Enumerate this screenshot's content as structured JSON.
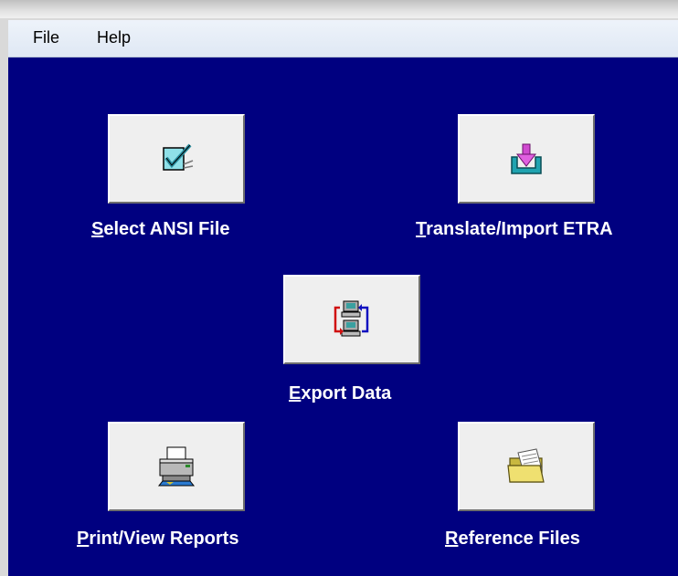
{
  "menu": {
    "file": "File",
    "help": "Help"
  },
  "buttons": {
    "select_ansi": {
      "accel": "S",
      "rest": "elect ANSI File",
      "icon": "checkmark-icon"
    },
    "translate_import": {
      "accel": "T",
      "rest": "ranslate/Import ETRA",
      "icon": "import-icon"
    },
    "export_data": {
      "accel": "E",
      "rest": "xport Data",
      "icon": "computers-exchange-icon"
    },
    "print_view": {
      "accel": "P",
      "rest": "rint/View Reports",
      "icon": "printer-icon"
    },
    "reference_files": {
      "accel": "R",
      "rest": "eference Files",
      "icon": "folder-icon"
    }
  },
  "colors": {
    "background": "#000080",
    "tile": "#efefef",
    "label": "#ffffff"
  }
}
